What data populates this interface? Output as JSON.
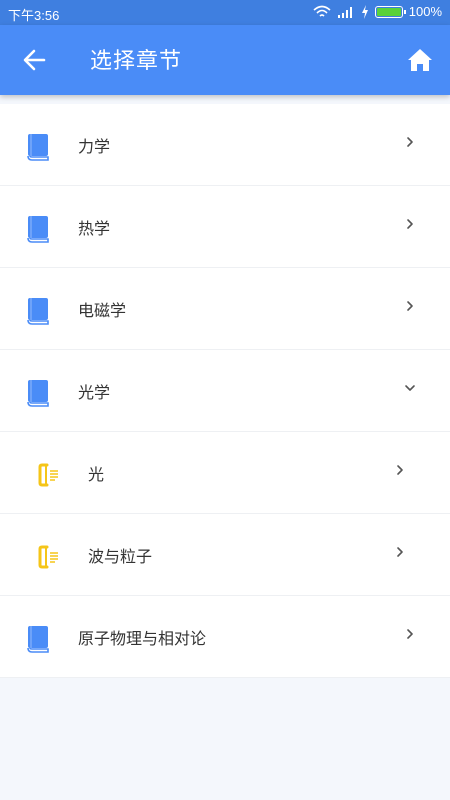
{
  "status_bar": {
    "time": "下午3:56",
    "battery_text": "100%",
    "battery_level": 1.0,
    "battery_color": "#59d23a"
  },
  "app_bar": {
    "title": "选择章节",
    "back_icon": "arrow-left-icon",
    "home_icon": "home-icon",
    "color": "#4a8cf7"
  },
  "chapters": [
    {
      "label": "力学",
      "level": 1,
      "icon": "book-icon",
      "state": "collapsed"
    },
    {
      "label": "热学",
      "level": 1,
      "icon": "book-icon",
      "state": "collapsed"
    },
    {
      "label": "电磁学",
      "level": 1,
      "icon": "book-icon",
      "state": "collapsed"
    },
    {
      "label": "光学",
      "level": 1,
      "icon": "book-icon",
      "state": "expanded"
    },
    {
      "label": "光",
      "level": 2,
      "icon": "lesson-icon",
      "state": "collapsed"
    },
    {
      "label": "波与粒子",
      "level": 2,
      "icon": "lesson-icon",
      "state": "collapsed"
    },
    {
      "label": "原子物理与相对论",
      "level": 1,
      "icon": "book-icon",
      "state": "collapsed"
    }
  ],
  "colors": {
    "book_icon": "#4a8cf7",
    "lesson_icon": "#f5c518"
  }
}
